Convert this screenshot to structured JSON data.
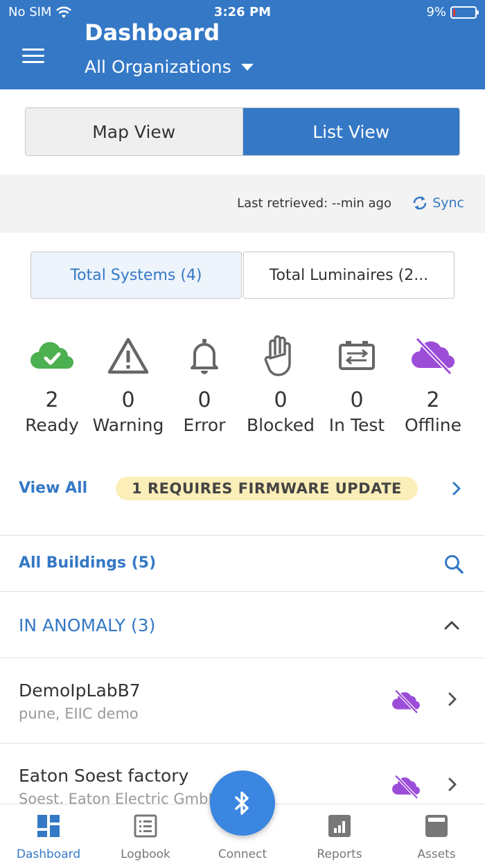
{
  "status_bar": {
    "carrier": "No SIM",
    "time": "3:26 PM",
    "battery": "9%",
    "battery_level": 0.09
  },
  "header": {
    "title": "Dashboard",
    "organization": "All Organizations"
  },
  "view_toggle": {
    "map_label": "Map View",
    "list_label": "List View",
    "selected": "List View"
  },
  "retrieved": {
    "text": "Last retrieved: --min ago",
    "sync_label": "Sync"
  },
  "totals": {
    "systems_label": "Total Systems (4)",
    "luminaires_label": "Total Luminaires (2..."
  },
  "statuses": [
    {
      "count": "2",
      "label": "Ready",
      "icon": "cloud-check-icon",
      "color": "#4caf50"
    },
    {
      "count": "0",
      "label": "Warning",
      "icon": "warning-icon",
      "color": "#666666"
    },
    {
      "count": "0",
      "label": "Error",
      "icon": "bell-icon",
      "color": "#666666"
    },
    {
      "count": "0",
      "label": "Blocked",
      "icon": "hand-icon",
      "color": "#666666"
    },
    {
      "count": "0",
      "label": "In Test",
      "icon": "test-battery-icon",
      "color": "#666666"
    },
    {
      "count": "2",
      "label": "Offline",
      "icon": "cloud-offline-icon",
      "color": "#9c4dd8"
    }
  ],
  "firmware": {
    "view_all_label": "View All",
    "badge": "1 REQUIRES FIRMWARE UPDATE"
  },
  "buildings": {
    "label": "All Buildings (5)"
  },
  "anomaly": {
    "label": "IN ANOMALY (3)"
  },
  "building_items": [
    {
      "name": "DemoIpLabB7",
      "subtitle": "pune, EIIC demo"
    },
    {
      "name": "Eaton Soest factory",
      "subtitle": "Soest, Eaton Electric GmbH"
    }
  ],
  "bottom_nav": {
    "dashboard": "Dashboard",
    "logbook": "Logbook",
    "connect": "Connect",
    "reports": "Reports",
    "assets": "Assets"
  },
  "colors": {
    "primary": "#3478c6",
    "offline": "#9c4dd8",
    "ready": "#4caf50",
    "badge": "#fbeeb8"
  }
}
